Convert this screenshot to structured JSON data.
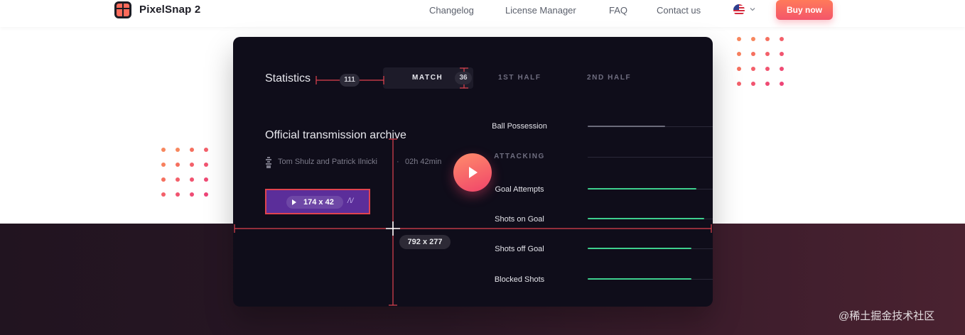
{
  "nav": {
    "brand": "PixelSnap 2",
    "links": [
      "Changelog",
      "License Manager",
      "FAQ",
      "Contact us"
    ],
    "buy_label": "Buy now",
    "language_icon": "us-flag-icon"
  },
  "card": {
    "statistics_title": "Statistics",
    "tabs": [
      "MATCH",
      "1ST HALF",
      "2ND HALF"
    ],
    "archive_title": "Official transmission archive",
    "authors": "Tom Shulz and Patrick Ilnicki",
    "separator": "·",
    "duration": "02h 42min",
    "stats_header": "ATTACKING",
    "stats": [
      {
        "label": "Ball Possession",
        "value": 0.62,
        "color": "#6b6b7a"
      },
      {
        "label": "Goal Attempts",
        "value": 0.87,
        "color": "#3ecf8e"
      },
      {
        "label": "Shots on Goal",
        "value": 0.93,
        "color": "#3ecf8e"
      },
      {
        "label": "Shots off Goal",
        "value": 0.83,
        "color": "#3ecf8e"
      },
      {
        "label": "Blocked Shots",
        "value": 0.83,
        "color": "#3ecf8e"
      }
    ]
  },
  "measurements": {
    "horizontal_gap": "111",
    "vertical_gap": "36",
    "button_size": "174 x 42",
    "card_size": "792 x 277"
  },
  "colors": {
    "accent": "#f4566a",
    "measure_line": "#e0434f",
    "card_bg": "#0f0d1a"
  },
  "watermark": "@稀土掘金技术社区"
}
